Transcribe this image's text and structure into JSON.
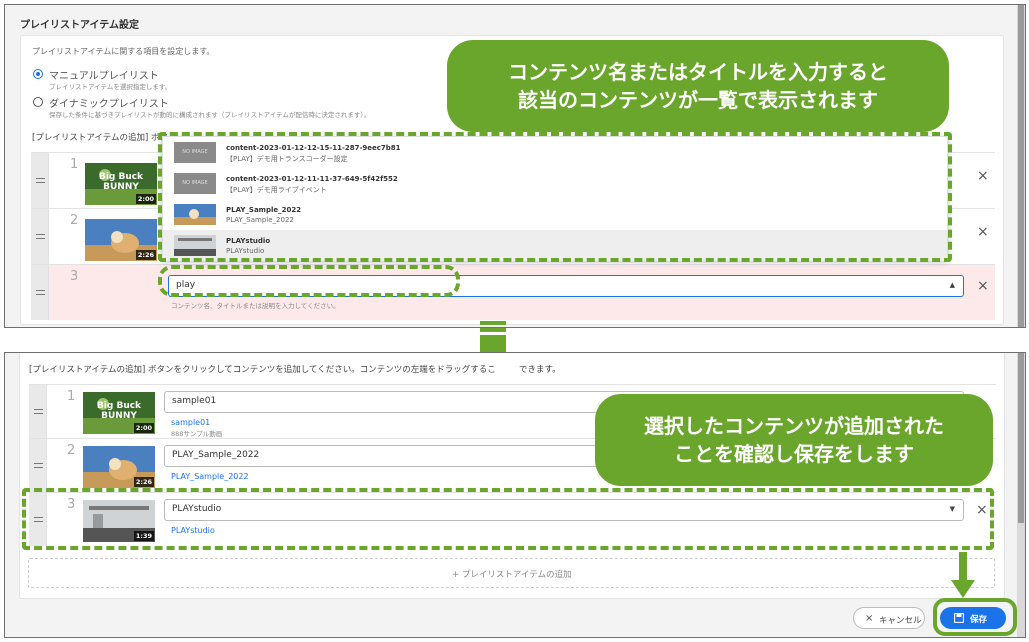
{
  "top_panel": {
    "section_title": "プレイリストアイテム設定",
    "description": "プレイリストアイテムに関する項目を設定します。",
    "radio_manual": {
      "label": "マニュアルプレイリスト",
      "sub": "プレイリストアイテムを選択指定します。"
    },
    "radio_dynamic": {
      "label": "ダイナミックプレイリスト",
      "sub": "保存した条件に基づきプレイリストが動的に構成されます（プレイリストアイテムが配信時に決定されます）。"
    },
    "add_hint_partial": "[プレイリストアイテムの追加] ボタン",
    "rows": [
      {
        "num": "1",
        "thumb": "bbb",
        "duration": "2:00"
      },
      {
        "num": "2",
        "thumb": "sample",
        "duration": "2:26"
      },
      {
        "num": "3"
      }
    ],
    "search_value": "play",
    "search_hint": "コンテンツ名、タイトルまたは説明を入力してください。",
    "dropdown": [
      {
        "thumb": "noimage",
        "line1": "content-2023-01-12-12-15-11-287-9eec7b81",
        "line2": "【PLAY】デモ用トランスコーダー設定"
      },
      {
        "thumb": "noimage",
        "line1": "content-2023-01-12-11-11-37-649-5f42f552",
        "line2": "【PLAY】デモ用ライブイベント"
      },
      {
        "thumb": "sample",
        "line1": "PLAY_Sample_2022",
        "line2": "PLAY_Sample_2022"
      },
      {
        "thumb": "studio",
        "line1": "PLAYstudio",
        "line2": "PLAYstudio"
      }
    ],
    "noimage_text": "NO IMAGE",
    "close_glyph": "×",
    "caret_up": "▲"
  },
  "bottom_panel": {
    "add_hint": "[プレイリストアイテムの追加] ボタンをクリックしてコンテンツを追加してください。コンテンツの左端をドラッグするこ",
    "add_hint_tail": "できます。",
    "rows": [
      {
        "num": "1",
        "duration": "2:00",
        "value": "sample01",
        "link": "sample01",
        "sub": "888サンプル動画"
      },
      {
        "num": "2",
        "duration": "2:26",
        "value": "PLAY_Sample_2022",
        "link": "PLAY_Sample_2022",
        "sub": ""
      },
      {
        "num": "3",
        "duration": "1:39",
        "value": "PLAYstudio",
        "link": "PLAYstudio",
        "sub": ""
      }
    ],
    "add_item_label": "プレイリストアイテムの追加",
    "plus_glyph": "+",
    "caret_down": "▼",
    "cancel_label": "キャンセル",
    "save_label": "保存"
  },
  "callout_top": {
    "line1": "コンテンツ名またはタイトルを入力すると",
    "line2": "該当のコンテンツが一覧で表示されます"
  },
  "callout_bottom": {
    "line1": "選択したコンテンツが追加された",
    "line2": "ことを確認し保存をします"
  },
  "thumb_text": {
    "big": "Big Buck",
    "bunny": "BUNNY"
  },
  "colors": {
    "accent": "#1a73e8",
    "annotation_green": "#6aa62c",
    "error_row": "#fde8ea"
  }
}
